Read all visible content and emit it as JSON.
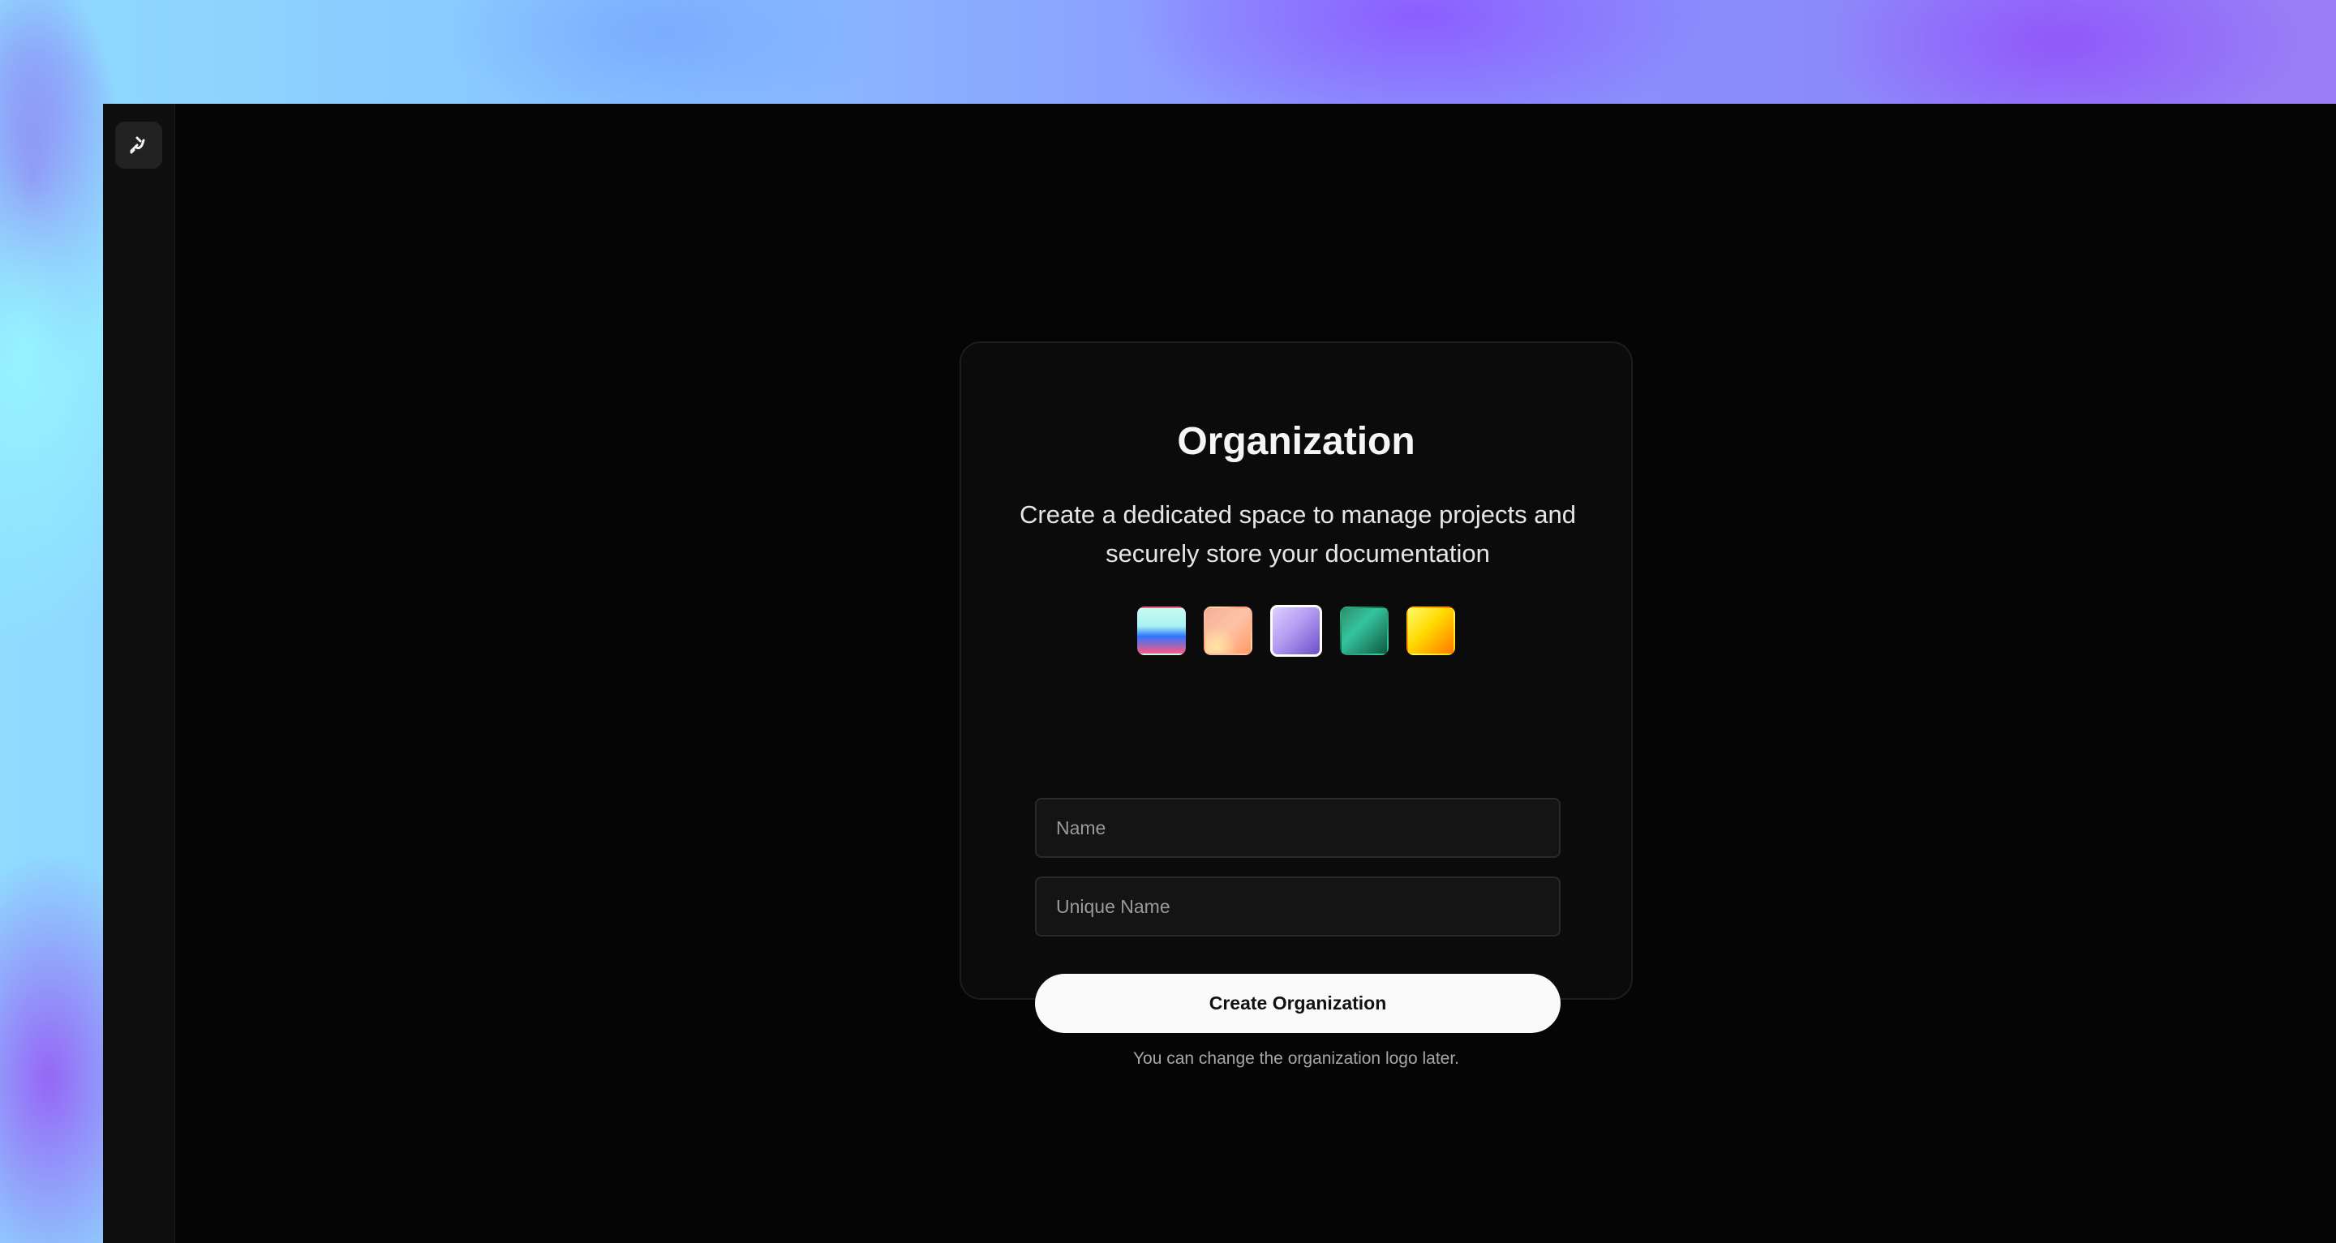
{
  "sidebar": {
    "logo_icon": "pen-nib-icon"
  },
  "card": {
    "title": "Organization",
    "description": "Create a dedicated space to manage projects and securely store your documentation",
    "logo_swatches": [
      {
        "name": "aqua-blue-pink",
        "selected": false
      },
      {
        "name": "peach",
        "selected": false
      },
      {
        "name": "lavender",
        "selected": true
      },
      {
        "name": "emerald",
        "selected": false
      },
      {
        "name": "yellow-orange",
        "selected": false
      }
    ],
    "name_field": {
      "placeholder": "Name",
      "value": ""
    },
    "unique_name_field": {
      "placeholder": "Unique Name",
      "value": ""
    },
    "submit_label": "Create Organization"
  },
  "footnote": "You can change the organization logo later."
}
